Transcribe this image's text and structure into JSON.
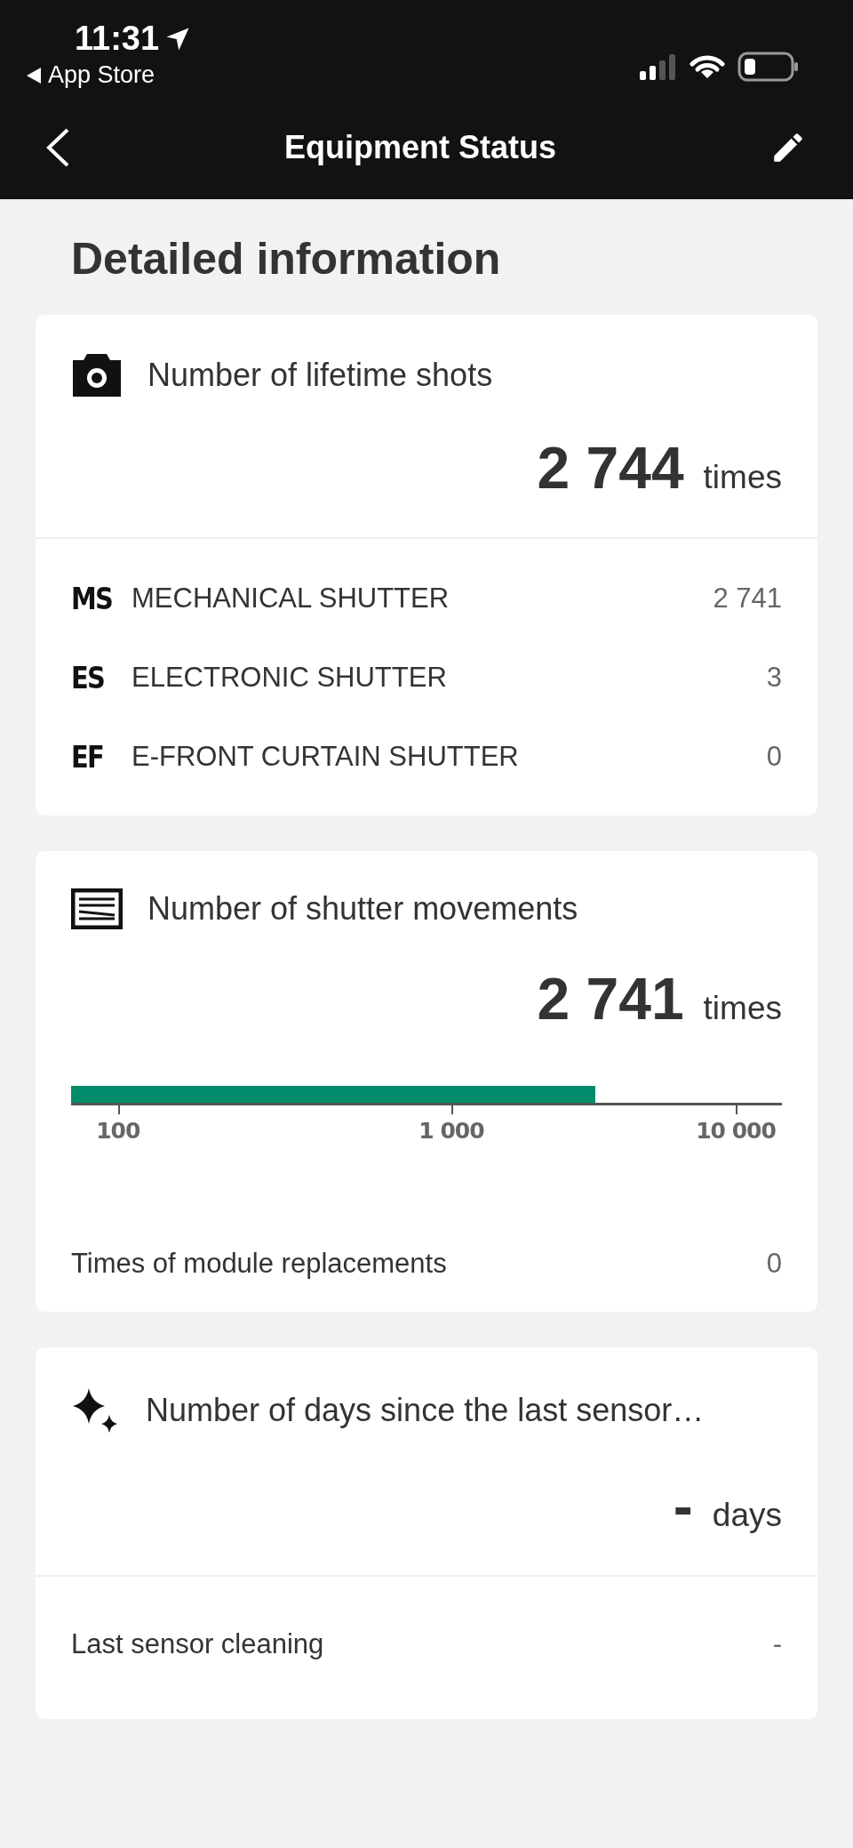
{
  "status_bar": {
    "time": "11:31",
    "back_app": "App Store"
  },
  "nav": {
    "title": "Equipment Status"
  },
  "heading": "Detailed information",
  "lifetime": {
    "title": "Number of lifetime shots",
    "value": "2 744",
    "unit": "times",
    "rows": [
      {
        "code": "MS",
        "label": "MECHANICAL SHUTTER",
        "value": "2 741"
      },
      {
        "code": "ES",
        "label": "ELECTRONIC SHUTTER",
        "value": "3"
      },
      {
        "code": "EF",
        "label": "E-FRONT CURTAIN SHUTTER",
        "value": "0"
      }
    ]
  },
  "shutter": {
    "title": "Number of shutter movements",
    "value": "2 741",
    "unit": "times",
    "level": 0.738,
    "ticks": [
      "100",
      "1 000",
      "10 000"
    ],
    "replacements_label": "Times of module replacements",
    "replacements_value": "0"
  },
  "cleaning": {
    "title": "Number of days since the last sensor…",
    "value": "-",
    "unit": "days",
    "last_label": "Last sensor cleaning",
    "last_value": "-"
  }
}
